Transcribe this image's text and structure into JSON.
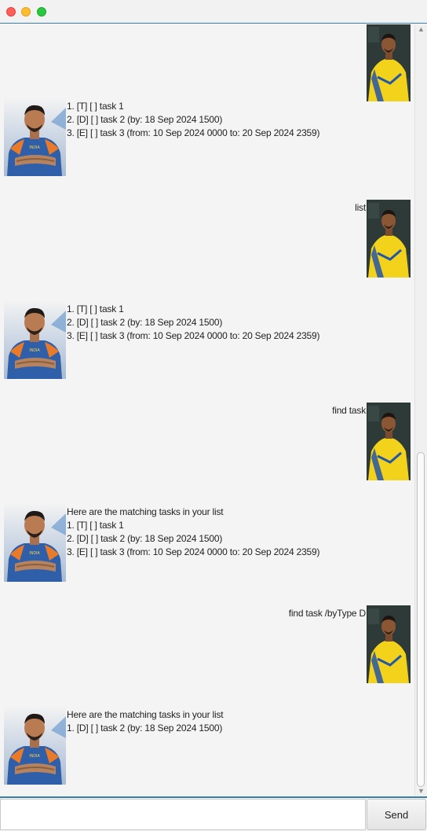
{
  "window": {
    "controls": [
      "close",
      "minimize",
      "maximize"
    ]
  },
  "dialog": [
    {
      "sender": "bot",
      "text": "1. [T] [ ] task 1\n2. [D] [ ] task 2 (by: 18 Sep 2024 1500)\n3. [E] [ ] task 3 (from: 10 Sep 2024 0000 to: 20 Sep 2024 2359)"
    },
    {
      "sender": "user",
      "text": "list"
    },
    {
      "sender": "bot",
      "text": "1. [T] [ ] task 1\n2. [D] [ ] task 2 (by: 18 Sep 2024 1500)\n3. [E] [ ] task 3 (from: 10 Sep 2024 0000 to: 20 Sep 2024 2359)"
    },
    {
      "sender": "user",
      "text": "find task"
    },
    {
      "sender": "bot",
      "text": "Here are the matching tasks in your list\n1. [T] [ ] task 1\n2. [D] [ ] task 2 (by: 18 Sep 2024 1500)\n3. [E] [ ] task 3 (from: 10 Sep 2024 0000 to: 20 Sep 2024 2359)"
    },
    {
      "sender": "user",
      "text": "find task /byType D"
    },
    {
      "sender": "bot",
      "text": "Here are the matching tasks in your list\n1. [D] [ ] task 2 (by: 18 Sep 2024 1500)"
    }
  ],
  "input": {
    "value": "",
    "placeholder": ""
  },
  "send": {
    "label": "Send"
  },
  "colors": {
    "accent": "#3a7fa8",
    "background": "#f4f4f4",
    "bot_jersey": "#2f5fa8",
    "user_jersey": "#f2d21b"
  },
  "icons": {
    "user_avatar": "user-avatar-image",
    "bot_avatar": "bot-avatar-image"
  }
}
